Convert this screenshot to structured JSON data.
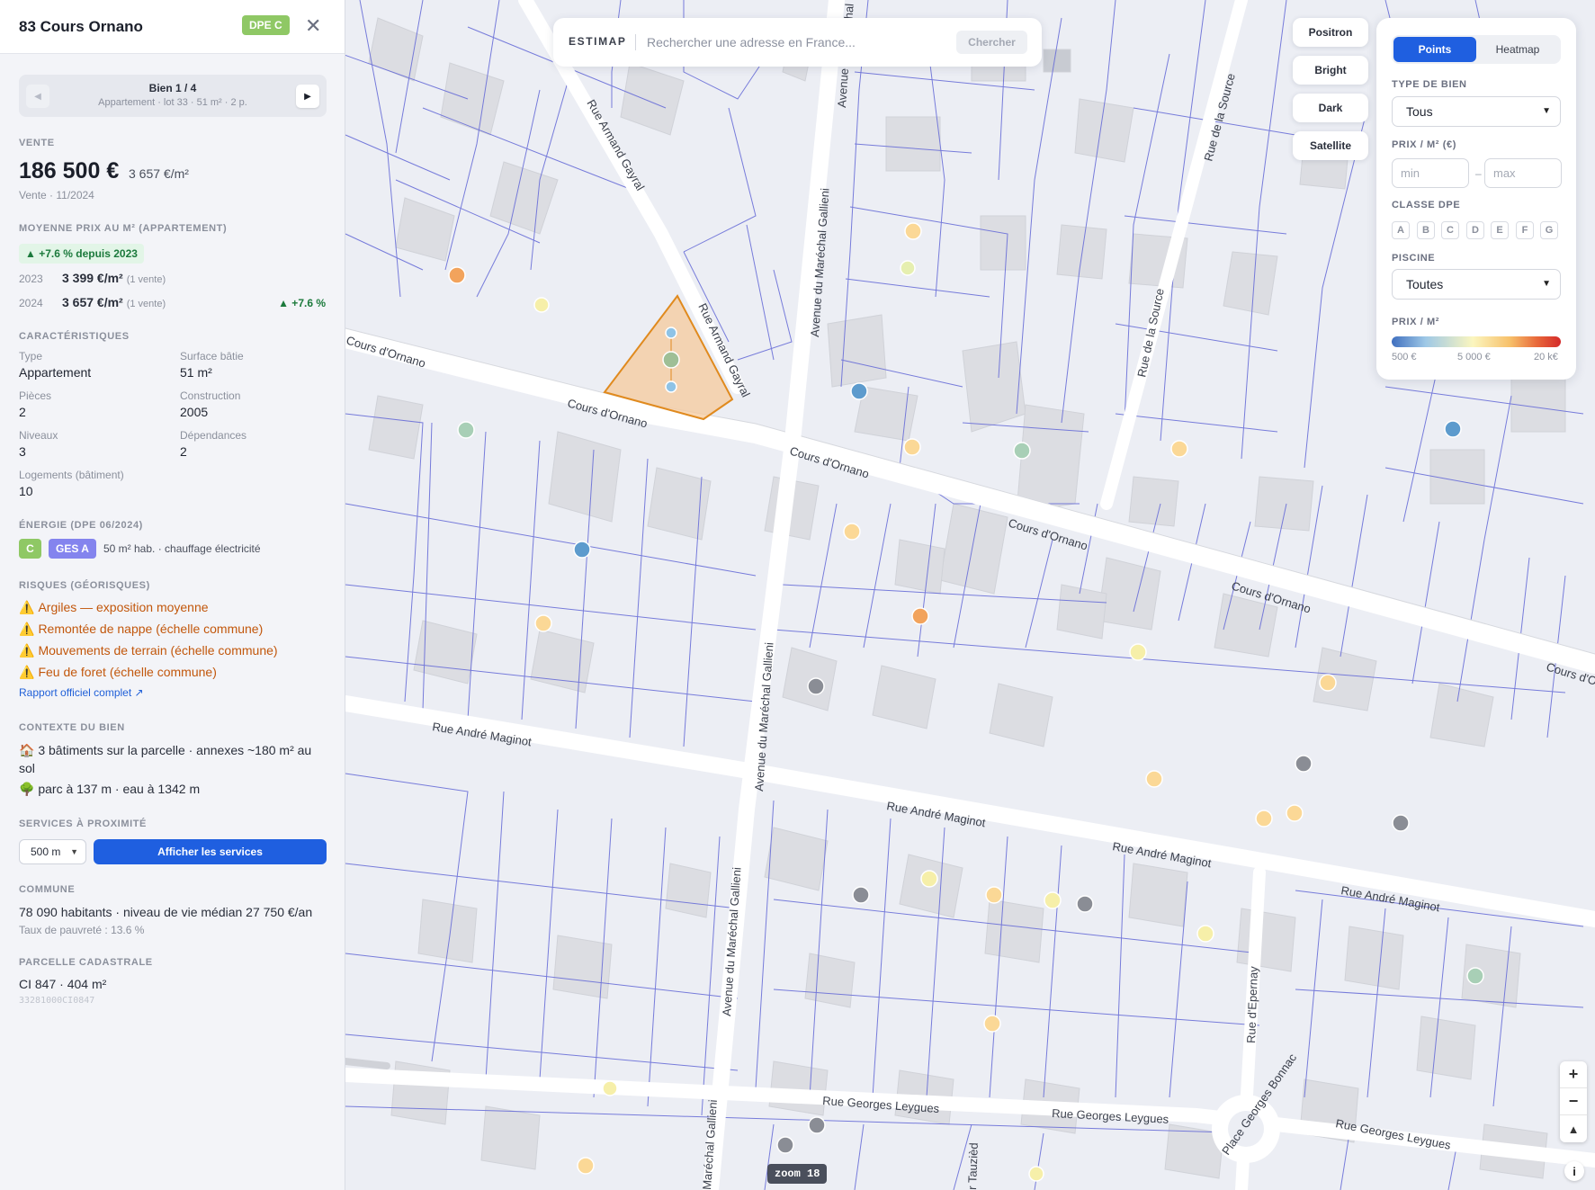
{
  "panel": {
    "address": "83 Cours Ornano",
    "dpe_badge": "DPE C",
    "close_symbol": "✕",
    "pager": {
      "title": "Bien 1 / 4",
      "subtitle": "Appartement · lot 33 · 51 m² · 2 p.",
      "prev_symbol": "◀",
      "next_symbol": "▶"
    },
    "sale": {
      "heading": "VENTE",
      "price": "186 500 €",
      "price_m2": "3 657 €/m²",
      "date_text": "Vente · 11/2024"
    },
    "average": {
      "heading": "MOYENNE PRIX AU M² (APPARTEMENT)",
      "trend_badge": "▲ +7.6 % depuis 2023",
      "rows": [
        {
          "year": "2023",
          "value": "3 399 €/m²",
          "count": "(1 vente)",
          "trend": ""
        },
        {
          "year": "2024",
          "value": "3 657 €/m²",
          "count": "(1 vente)",
          "trend": "▲ +7.6 %"
        }
      ]
    },
    "characteristics": {
      "heading": "CARACTÉRISTIQUES",
      "items": [
        {
          "label": "Type",
          "value": "Appartement"
        },
        {
          "label": "Surface bâtie",
          "value": "51 m²"
        },
        {
          "label": "Pièces",
          "value": "2"
        },
        {
          "label": "Construction",
          "value": "2005"
        },
        {
          "label": "Niveaux",
          "value": "3"
        },
        {
          "label": "Dépendances",
          "value": "2"
        },
        {
          "label": "Logements (bâtiment)",
          "value": "10"
        }
      ]
    },
    "energy": {
      "heading": "ÉNERGIE (DPE 06/2024)",
      "dpe": "C",
      "ges": "GES A",
      "text": "50 m² hab. · chauffage électricité"
    },
    "risks": {
      "heading": "RISQUES (GÉORISQUES)",
      "warning_symbol": "⚠️",
      "items": [
        "Argiles — exposition moyenne",
        "Remontée de nappe (échelle commune)",
        "Mouvements de terrain (échelle commune)",
        "Feu de foret (échelle commune)"
      ],
      "link": "Rapport officiel complet ↗"
    },
    "context": {
      "heading": "CONTEXTE DU BIEN",
      "line1_icon": "🏠",
      "line1": "3 bâtiments sur la parcelle · annexes ~180 m² au sol",
      "line2_icon": "🌳",
      "line2": "parc à 137 m · eau à 1342 m"
    },
    "services": {
      "heading": "SERVICES À PROXIMITÉ",
      "radius": "500 m",
      "button": "Afficher les services"
    },
    "commune": {
      "heading": "COMMUNE",
      "line1": "78 090 habitants · niveau de vie médian 27 750 €/an",
      "line2": "Taux de pauvreté : 13.6 %"
    },
    "parcel": {
      "heading": "PARCELLE CADASTRALE",
      "line1": "CI 847 · 404 m²",
      "code": "33281000CI0847"
    }
  },
  "search": {
    "brand": "ESTIMAP",
    "placeholder": "Rechercher une adresse en France...",
    "button": "Chercher"
  },
  "map_styles": [
    "Positron",
    "Bright",
    "Dark",
    "Satellite"
  ],
  "filters": {
    "mode_active": "Points",
    "mode_other": "Heatmap",
    "type_label": "TYPE DE BIEN",
    "type_value": "Tous",
    "price_label": "PRIX / M² (€)",
    "price_min_placeholder": "min",
    "price_max_placeholder": "max",
    "price_dash": "–",
    "dpe_label": "CLASSE DPE",
    "dpe_classes": [
      "A",
      "B",
      "C",
      "D",
      "E",
      "F",
      "G"
    ],
    "pool_label": "PISCINE",
    "pool_value": "Toutes",
    "scale_label": "PRIX / M²",
    "scale_ticks": [
      "500 €",
      "5 000 €",
      "20 k€"
    ]
  },
  "map": {
    "zoom_label": "zoom",
    "zoom_value": "18",
    "zoom_in": "+",
    "zoom_out": "−",
    "compass": "▲",
    "info": "i",
    "streets": [
      {
        "name": "Cours d'Ornano"
      },
      {
        "name": "Cours d'Ornano"
      },
      {
        "name": "Cours d'Ornano"
      },
      {
        "name": "Cours d'Ornano"
      },
      {
        "name": "Cours d'Ornano"
      },
      {
        "name": "Cours d'O"
      },
      {
        "name": "Rue Armand Gayral"
      },
      {
        "name": "Rue Armand Gayral"
      },
      {
        "name": "Avenue du Maréchal Gallieni"
      },
      {
        "name": "Avenue du Maréchal Gallieni"
      },
      {
        "name": "Avenue du Maréchal Gallieni"
      },
      {
        "name": "Maréchal Gallieni"
      },
      {
        "name": "Avenue"
      },
      {
        "name": "Rue de la Source"
      },
      {
        "name": "Rue de la Source"
      },
      {
        "name": "Rue André Maginot"
      },
      {
        "name": "Rue André Maginot"
      },
      {
        "name": "Rue André Maginot"
      },
      {
        "name": "Rue André Maginot"
      },
      {
        "name": "Rue Georges Leygues"
      },
      {
        "name": "Rue Georges Leygues"
      },
      {
        "name": "Rue Georges Leygues"
      },
      {
        "name": "Rue d'Epernay"
      },
      {
        "name": "Place Georges Bonnac"
      },
      {
        "name": "r Tauzièd"
      },
      {
        "name": "chal"
      }
    ],
    "colors": {
      "orange": "#f2a35c",
      "yellow": "#fbd896",
      "pale": "#f6efa9",
      "blue": "#5d9bcd",
      "green": "#a8cfb6",
      "grey": "#8a8d95",
      "parcel": "#e89a3c"
    }
  }
}
